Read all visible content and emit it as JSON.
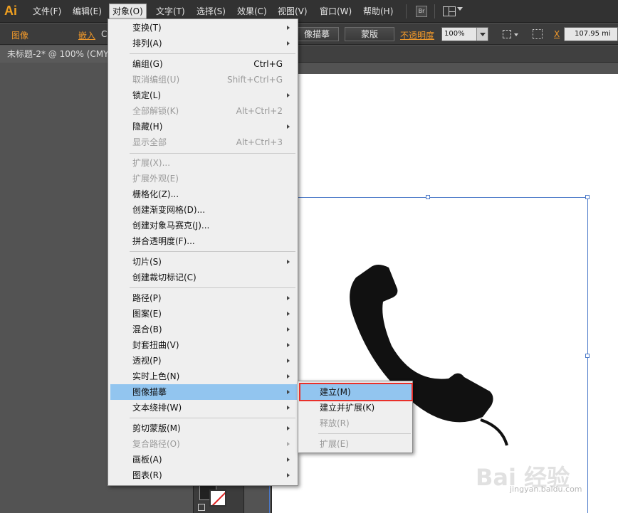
{
  "app": {
    "logo": "Ai"
  },
  "menubar": {
    "items": [
      "文件(F)",
      "编辑(E)",
      "对象(O)",
      "文字(T)",
      "选择(S)",
      "效果(C)",
      "视图(V)",
      "窗口(W)",
      "帮助(H)"
    ],
    "active_item": "对象(O)",
    "bridge_icon_label": "Br"
  },
  "controlbar": {
    "image_label": "图像",
    "embed_label": "嵌入",
    "embed_trailing": "C",
    "trace_button": "像描摹",
    "mask_button": "蒙版",
    "opacity_label": "不透明度",
    "opacity_value": "100%",
    "x_label": "X",
    "x_value": "107.95 mi"
  },
  "document": {
    "tab_title": "未标题-2* @ 100% (CMY"
  },
  "object_menu": {
    "items": [
      {
        "label": "变换(T)",
        "submenu": true
      },
      {
        "label": "排列(A)",
        "submenu": true
      },
      {
        "label": "编组(G)",
        "shortcut": "Ctrl+G"
      },
      {
        "label": "取消编组(U)",
        "shortcut": "Shift+Ctrl+G",
        "disabled": true
      },
      {
        "label": "锁定(L)",
        "submenu": true
      },
      {
        "label": "全部解锁(K)",
        "shortcut": "Alt+Ctrl+2",
        "disabled": true
      },
      {
        "label": "隐藏(H)",
        "submenu": true
      },
      {
        "label": "显示全部",
        "shortcut": "Alt+Ctrl+3",
        "disabled": true
      },
      {
        "label": "扩展(X)...",
        "disabled": true
      },
      {
        "label": "扩展外观(E)",
        "disabled": true
      },
      {
        "label": "栅格化(Z)..."
      },
      {
        "label": "创建渐变网格(D)..."
      },
      {
        "label": "创建对象马赛克(J)..."
      },
      {
        "label": "拼合透明度(F)..."
      },
      {
        "label": "切片(S)",
        "submenu": true
      },
      {
        "label": "创建裁切标记(C)"
      },
      {
        "label": "路径(P)",
        "submenu": true
      },
      {
        "label": "图案(E)",
        "submenu": true
      },
      {
        "label": "混合(B)",
        "submenu": true
      },
      {
        "label": "封套扭曲(V)",
        "submenu": true
      },
      {
        "label": "透视(P)",
        "submenu": true
      },
      {
        "label": "实时上色(N)",
        "submenu": true
      },
      {
        "label": "图像描摹",
        "submenu": true,
        "highlighted": true
      },
      {
        "label": "文本绕排(W)",
        "submenu": true
      },
      {
        "label": "剪切蒙版(M)",
        "submenu": true
      },
      {
        "label": "复合路径(O)",
        "submenu": true,
        "disabled": true
      },
      {
        "label": "画板(A)",
        "submenu": true
      },
      {
        "label": "图表(R)",
        "submenu": true
      }
    ]
  },
  "image_trace_submenu": {
    "items": [
      {
        "label": "建立(M)",
        "highlighted": true
      },
      {
        "label": "建立并扩展(K)"
      },
      {
        "label": "释放(R)",
        "disabled": true
      },
      {
        "label": "扩展(E)",
        "disabled": true
      }
    ]
  },
  "watermark": {
    "text": "Bai 经验",
    "url": "jingyan.baidu.com"
  },
  "colors": {
    "highlight": "#92c5ef",
    "callout_outline": "#e8302a",
    "accent_orange": "#f0982a"
  }
}
